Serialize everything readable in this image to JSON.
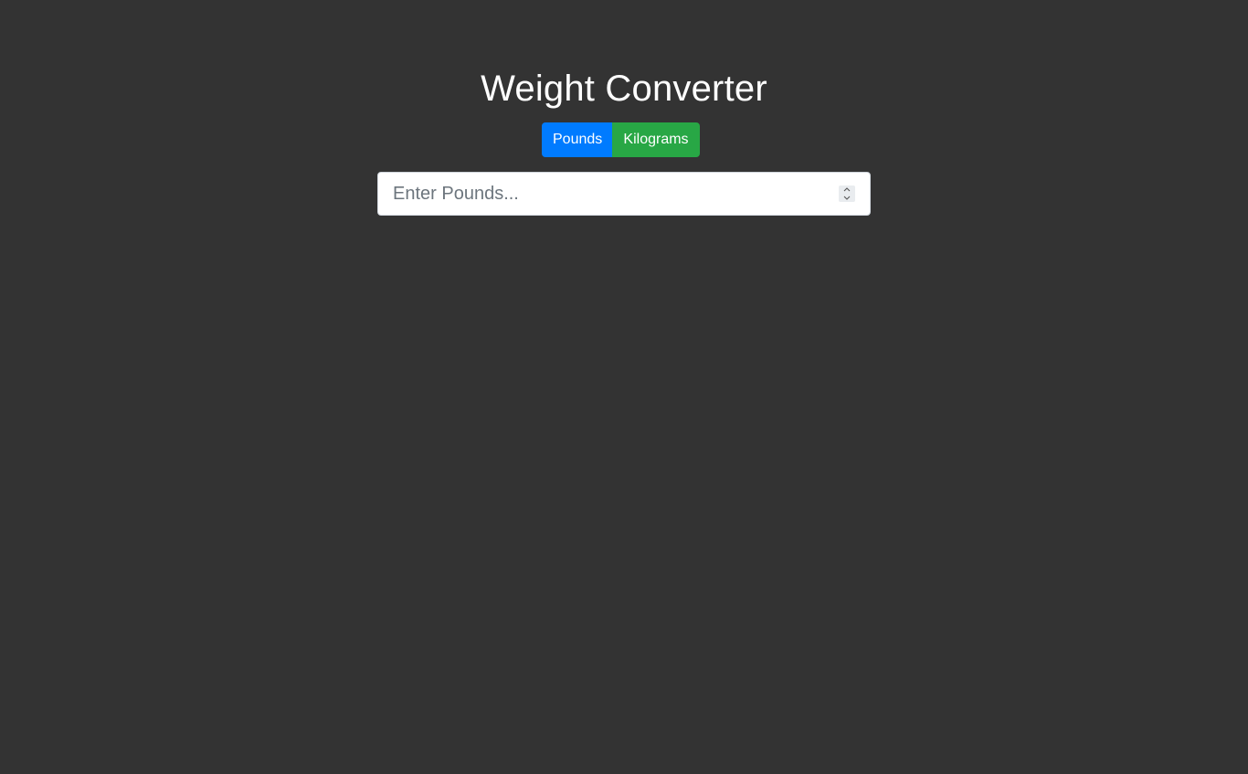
{
  "header": {
    "title": "Weight Converter"
  },
  "unit_toggle": {
    "pounds_label": "Pounds",
    "kilograms_label": "Kilograms"
  },
  "input": {
    "value": "",
    "placeholder": "Enter Pounds..."
  },
  "colors": {
    "background": "#333333",
    "pounds_button": "#007bff",
    "kilograms_button": "#28a745"
  },
  "icons": {
    "spinner_up": "chevron-up-icon",
    "spinner_down": "chevron-down-icon"
  }
}
